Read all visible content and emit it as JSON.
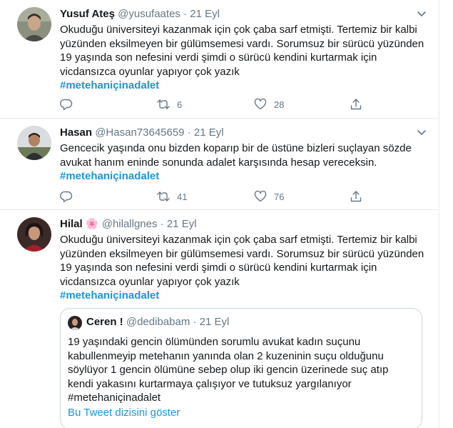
{
  "tweets": [
    {
      "name": "Yusuf Ateş",
      "handle": "@yusufaates",
      "separator": "·",
      "date": "21 Eyl",
      "lines": [
        "Okuduğu üniversiteyi kazanmak için çok çaba sarf etmişti. Tertemiz bir kalbi",
        "yüzünden eksilmeyen bir gülümsemesi vardı. Sorumsuz bir sürücü yüzünden",
        "19 yaşında son nefesini verdi şimdi o sürücü kendini kurtarmak için",
        "vicdansızca oyunlar yapıyor çok yazık"
      ],
      "hashtag": "#metehaniçinadalet",
      "retweets": "6",
      "likes": "28"
    },
    {
      "name": "Hasan",
      "handle": "@Hasan73645659",
      "separator": "·",
      "date": "21 Eyl",
      "lines": [
        "Gencecik yaşında onu bizden koparıp bir de üstüne bizleri suçlayan sözde",
        "avukat hanım eninde sonunda adalet karşısında hesap vereceksin."
      ],
      "hashtag": "#metehaniçinadalet",
      "retweets": "41",
      "likes": "76"
    },
    {
      "name": "Hilal",
      "name_emoji": "🌸",
      "handle": "@hilallgnes",
      "separator": "·",
      "date": "21 Eyl",
      "lines": [
        "Okuduğu üniversiteyi kazanmak için çok çaba sarf etmişti. Tertemiz bir kalbi",
        "yüzünden eksilmeyen bir gülümsemesi vardı. Sorumsuz bir sürücü yüzünden",
        "19 yaşında son nefesini verdi şimdi o sürücü kendini kurtarmak için",
        "vicdansızca oyunlar yapıyor çok yazık"
      ],
      "hashtag": "#metehaniçinadalet",
      "quote": {
        "name": "Ceren !",
        "handle": "@dedibabam",
        "separator": "·",
        "date": "21 Eyl",
        "lines": [
          "19 yaşındaki gencin ölümünden sorumlu avukat kadın suçunu",
          "kabullenmeyip metehanın yanında olan 2 kuzeninin suçu olduğunu",
          "söylüyor 1 gencin ölümüne sebep olup iki gencin üzerinede suç atıp",
          "kendi yakasını kurtarmaya çalışıyor ve tutuksuz yargılanıyor",
          "#metehaniçinadalet"
        ],
        "thread_link": "Bu Tweet dizisini göster"
      }
    }
  ],
  "icons": {
    "reply": "reply-icon",
    "retweet": "retweet-icon",
    "like": "like-icon",
    "share": "share-icon",
    "more": "chevron-down-icon"
  },
  "colors": {
    "text": "#14171a",
    "secondary": "#657786",
    "link": "#1b95e0",
    "border": "#e6ecf0"
  }
}
